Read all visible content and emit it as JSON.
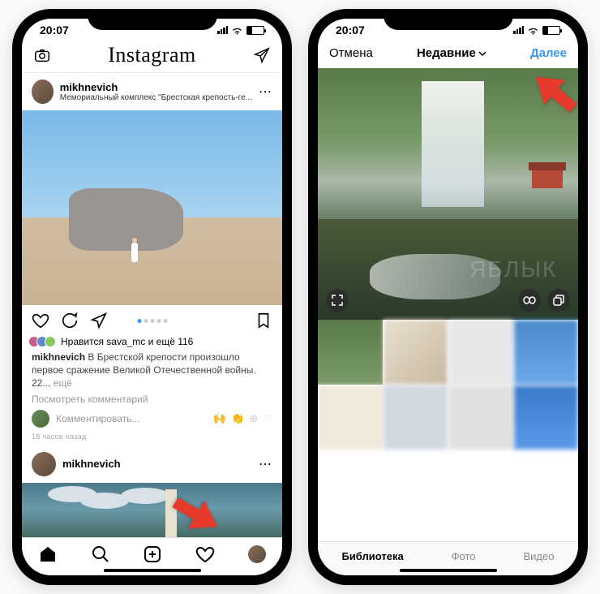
{
  "status": {
    "time": "20:07"
  },
  "phone1": {
    "app_title": "Instagram",
    "post": {
      "username": "mikhnevich",
      "location": "Мемориальный комплекс \"Брестская крепость-ге...",
      "likes_text": "Нравится sava_mc и ещё 116",
      "caption_user": "mikhnevich",
      "caption_text": "В Брестской крепости произошло первое сражение Великой Отечественной войны. 22...",
      "caption_more": "ещё",
      "view_comments": "Посмотреть комментарий",
      "comment_placeholder": "Комментировать...",
      "timestamp": "18 часов назад"
    },
    "post2": {
      "username": "mikhnevich"
    }
  },
  "phone2": {
    "cancel": "Отмена",
    "recent": "Недавние",
    "next": "Далее",
    "tabs": {
      "library": "Библиотека",
      "photo": "Фото",
      "video": "Видео"
    }
  },
  "emojis": {
    "e1": "🙌",
    "e2": "👏",
    "heart": "♡"
  },
  "watermark": "ЯБЛЫК"
}
